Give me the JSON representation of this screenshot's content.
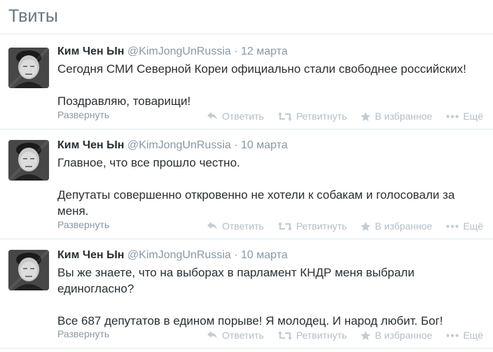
{
  "header": {
    "title": "Твиты"
  },
  "tweets": [
    {
      "fullname": "Ким Чен Ын",
      "username": "@KimJongUnRussia",
      "separator": "·",
      "date": "12 марта",
      "paragraphs": [
        "Сегодня СМИ Северной Кореи официально стали свободнее российских!",
        "Поздравляю, товарищи!"
      ],
      "expand": "Развернуть"
    },
    {
      "fullname": "Ким Чен Ын",
      "username": "@KimJongUnRussia",
      "separator": "·",
      "date": "10 марта",
      "paragraphs": [
        "Главное, что все прошло честно.",
        "Депутаты совершенно откровенно не хотели к собакам и голосовали за меня."
      ],
      "expand": "Развернуть"
    },
    {
      "fullname": "Ким Чен Ын",
      "username": "@KimJongUnRussia",
      "separator": "·",
      "date": "10 марта",
      "paragraphs": [
        "Вы же знаете, что на выборах в парламент КНДР меня выбрали единогласно?",
        "Все 687 депутатов в едином порыве! Я молодец. И народ любит. Бог!"
      ],
      "expand": "Развернуть"
    }
  ],
  "actions": {
    "reply": "Ответить",
    "retweet": "Ретвитнуть",
    "favorite": "В избранное",
    "more": "Ещё"
  },
  "icons": [
    "reply-icon",
    "retweet-icon",
    "star-icon",
    "more-dots-icon"
  ]
}
